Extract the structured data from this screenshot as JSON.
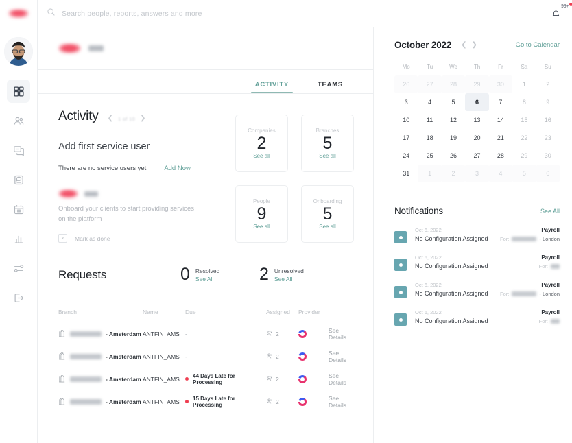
{
  "theme": {
    "accent": "#5e9e96",
    "danger": "#ef3e51",
    "notif_icon": "#67a6b0",
    "today_bg": "#eef1f5"
  },
  "topbar": {
    "search_placeholder": "Search people, reports, answers and more",
    "search_value": "",
    "notification_badge": "99+"
  },
  "sidebar": {
    "items": [
      {
        "name": "dashboard",
        "active": true
      },
      {
        "name": "people",
        "active": false
      },
      {
        "name": "messages",
        "active": false
      },
      {
        "name": "inbox",
        "active": false
      },
      {
        "name": "calendar",
        "active": false
      },
      {
        "name": "analytics",
        "active": false
      },
      {
        "name": "settings",
        "active": false
      },
      {
        "name": "logout",
        "active": false
      }
    ]
  },
  "tabs": [
    {
      "label": "ACTIVITY",
      "active": true
    },
    {
      "label": "TEAMS",
      "active": false
    }
  ],
  "activity": {
    "title": "Activity",
    "pager_label": "1 of 10",
    "prev_icon": "chevron-left-icon",
    "next_icon": "chevron-right-icon",
    "headline": "Add first service user",
    "note": "There are no service users yet",
    "add_now": "Add Now",
    "onboard_desc": "Onboard your clients to start providing services on the platform",
    "mark_done": "Mark as done",
    "checkbox_glyph": "×"
  },
  "stats": [
    {
      "label": "Companies",
      "value": "2",
      "link": "See all"
    },
    {
      "label": "Branches",
      "value": "5",
      "link": "See all"
    },
    {
      "label": "People",
      "value": "9",
      "link": "See all"
    },
    {
      "label": "Onboarding",
      "value": "5",
      "link": "See all"
    }
  ],
  "requests": {
    "title": "Requests",
    "resolved": {
      "count": "0",
      "label": "Resolved",
      "link": "See All"
    },
    "unresolved": {
      "count": "2",
      "label": "Unresolved",
      "link": "See All"
    },
    "columns": [
      "Branch",
      "Name",
      "Due",
      "Assigned",
      "Provider",
      ""
    ],
    "rows": [
      {
        "branch_city": "- Amsterdam",
        "name": "ANTFIN_AMS",
        "due": "-",
        "due_late": false,
        "assigned": "2",
        "action": "See Details"
      },
      {
        "branch_city": "- Amsterdam",
        "name": "ANTFIN_AMS",
        "due": "-",
        "due_late": false,
        "assigned": "2",
        "action": "See Details"
      },
      {
        "branch_city": "- Amsterdam",
        "name": "ANTFIN_AMS",
        "due": "44 Days Late for Processing",
        "due_late": true,
        "assigned": "2",
        "action": "See Details"
      },
      {
        "branch_city": "- Amsterdam",
        "name": "ANTFIN_AMS",
        "due": "15 Days Late for Processing",
        "due_late": true,
        "assigned": "2",
        "action": "See Details"
      }
    ]
  },
  "calendar": {
    "month": "October 2022",
    "prev_icon": "chevron-left-icon",
    "next_icon": "chevron-right-icon",
    "goto_label": "Go to Calendar",
    "dow": [
      "Mo",
      "Tu",
      "We",
      "Th",
      "Fr",
      "Sa",
      "Su"
    ],
    "weeks": [
      [
        {
          "d": "26",
          "type": "out"
        },
        {
          "d": "27",
          "type": "out"
        },
        {
          "d": "28",
          "type": "out"
        },
        {
          "d": "29",
          "type": "out"
        },
        {
          "d": "30",
          "type": "out"
        },
        {
          "d": "1",
          "type": "weekend"
        },
        {
          "d": "2",
          "type": "weekend"
        }
      ],
      [
        {
          "d": "3",
          "type": "day"
        },
        {
          "d": "4",
          "type": "day"
        },
        {
          "d": "5",
          "type": "day"
        },
        {
          "d": "6",
          "type": "today"
        },
        {
          "d": "7",
          "type": "day"
        },
        {
          "d": "8",
          "type": "weekend"
        },
        {
          "d": "9",
          "type": "weekend"
        }
      ],
      [
        {
          "d": "10",
          "type": "day"
        },
        {
          "d": "11",
          "type": "day"
        },
        {
          "d": "12",
          "type": "day"
        },
        {
          "d": "13",
          "type": "day"
        },
        {
          "d": "14",
          "type": "day"
        },
        {
          "d": "15",
          "type": "weekend"
        },
        {
          "d": "16",
          "type": "weekend"
        }
      ],
      [
        {
          "d": "17",
          "type": "day"
        },
        {
          "d": "18",
          "type": "day"
        },
        {
          "d": "19",
          "type": "day"
        },
        {
          "d": "20",
          "type": "day"
        },
        {
          "d": "21",
          "type": "day"
        },
        {
          "d": "22",
          "type": "weekend"
        },
        {
          "d": "23",
          "type": "weekend"
        }
      ],
      [
        {
          "d": "24",
          "type": "day"
        },
        {
          "d": "25",
          "type": "day"
        },
        {
          "d": "26",
          "type": "day"
        },
        {
          "d": "27",
          "type": "day"
        },
        {
          "d": "28",
          "type": "day"
        },
        {
          "d": "29",
          "type": "weekend"
        },
        {
          "d": "30",
          "type": "weekend"
        }
      ],
      [
        {
          "d": "31",
          "type": "day"
        },
        {
          "d": "1",
          "type": "out"
        },
        {
          "d": "2",
          "type": "out"
        },
        {
          "d": "3",
          "type": "out"
        },
        {
          "d": "4",
          "type": "out"
        },
        {
          "d": "5",
          "type": "out"
        },
        {
          "d": "6",
          "type": "out"
        }
      ]
    ]
  },
  "notifications": {
    "title": "Notifications",
    "see_all": "See All",
    "for_label": "For:",
    "items": [
      {
        "date": "Oct 6, 2022",
        "category": "Payroll",
        "message": "No Configuration Assigned",
        "city": "- London",
        "has_city": true
      },
      {
        "date": "Oct 6, 2022",
        "category": "Payroll",
        "message": "No Configuration Assigned",
        "city": "",
        "has_city": false
      },
      {
        "date": "Oct 6, 2022",
        "category": "Payroll",
        "message": "No Configuration Assigned",
        "city": "- London",
        "has_city": true
      },
      {
        "date": "Oct 6, 2022",
        "category": "Payroll",
        "message": "No Configuration Assigned",
        "city": "",
        "has_city": false
      }
    ]
  }
}
